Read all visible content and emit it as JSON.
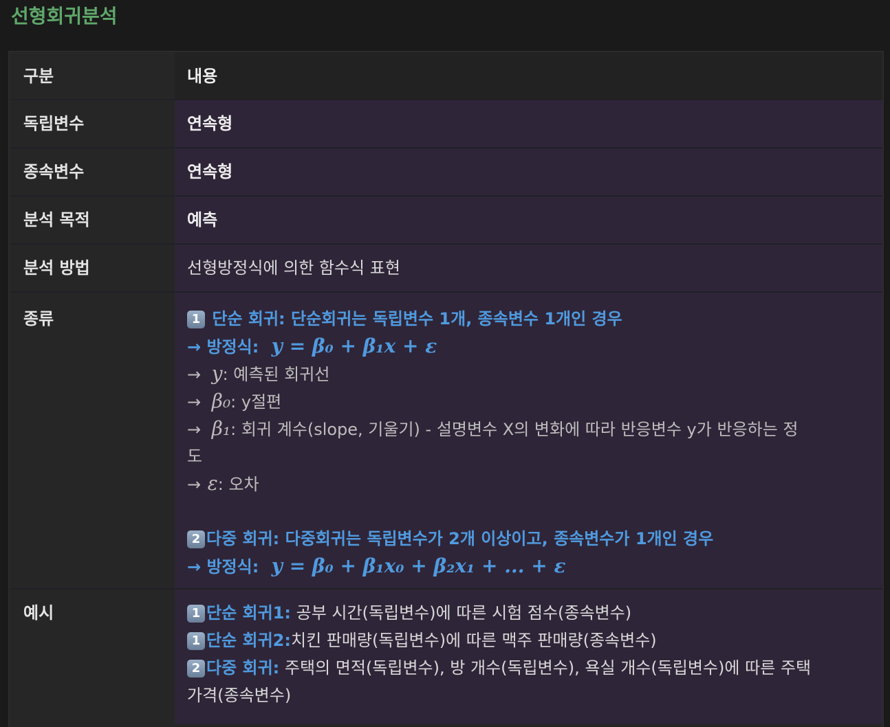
{
  "title": "선형회귀분석",
  "header": {
    "col1": "구분",
    "col2": "내용"
  },
  "rows": [
    {
      "label": "독립변수",
      "value": "연속형"
    },
    {
      "label": "종속변수",
      "value": "연속형"
    },
    {
      "label": "분석 목적",
      "value": "예측"
    },
    {
      "label": "분석 방법",
      "value": "선형방정식에 의한 함수식 표현"
    }
  ],
  "kinds": {
    "label": "종류",
    "simple": {
      "badge": "1",
      "heading": "단순 회귀: 단순회귀는 독립변수 1개, 종속변수 1개인 경우",
      "eq_label": "→ 방정식:",
      "eq": "y = β₀ + β₁x + ε",
      "y_sym": "y",
      "y_desc": ": 예측된 회귀선",
      "b0_sym": "β₀",
      "b0_desc": ": y절편",
      "b1_sym": "β₁",
      "b1_desc_1": ": 회귀 계수(slope, 기울기) - 설명변수 X의 변화에 따라 반응변수 y가 반응하는 정",
      "b1_desc_2": "도",
      "eps_sym": "ε",
      "eps_desc": ": 오차",
      "arrow": "→"
    },
    "multi": {
      "badge": "2",
      "heading": "다중 회귀: 다중회귀는 독립변수가 2개 이상이고, 종속변수가 1개인 경우",
      "eq_label": "→ 방정식:",
      "eq": "y = β₀ + β₁x₀ + β₂x₁ + ... + ε"
    }
  },
  "examples": {
    "label": "예시",
    "items": [
      {
        "badge": "1",
        "head": "단순 회귀1:",
        "text": " 공부 시간(독립변수)에 따른 시험 점수(종속변수)"
      },
      {
        "badge": "1",
        "head": "단순 회귀2:",
        "text": "치킨 판매량(독립변수)에 따른 맥주 판매량(종속변수)"
      },
      {
        "badge": "2",
        "head": "다중 회귀:",
        "text": " 주택의 면적(독립변수), 방 개수(독립변수), 욕실 개수(독립변수)에 따른 주택",
        "text2": "가격(종속변수)"
      }
    ]
  }
}
